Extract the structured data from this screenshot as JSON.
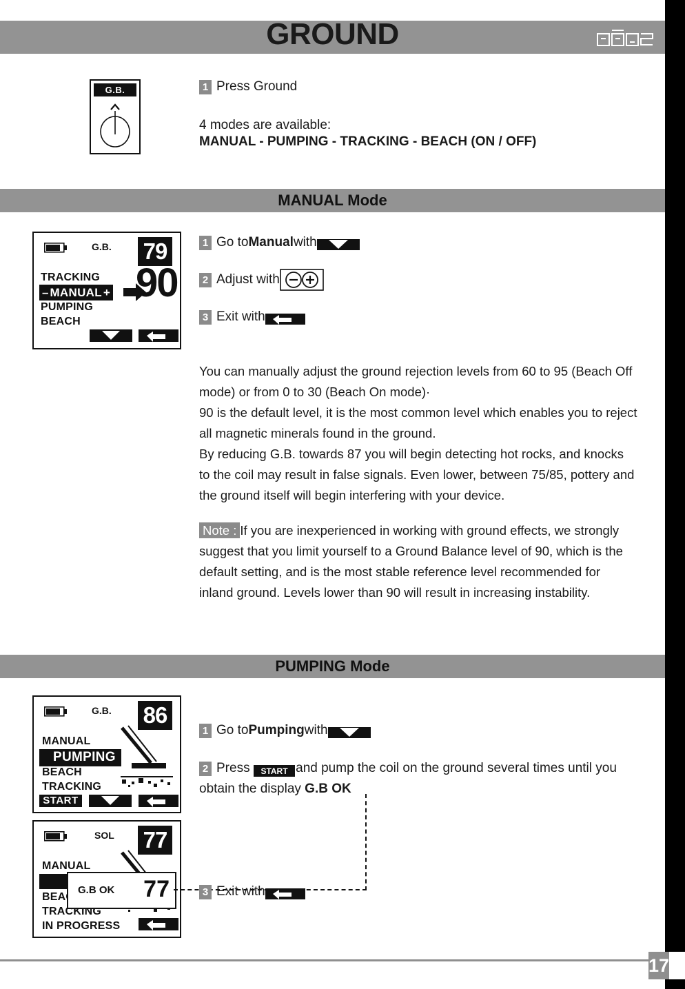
{
  "header": {
    "title": "GROUND",
    "logo_text": "DEUS"
  },
  "intro": {
    "knob_label": "G.B.",
    "step1_num": "1",
    "step1_text": "Press Ground",
    "modes_intro": "4 modes are available:",
    "modes_list": "MANUAL - PUMPING - TRACKING - BEACH (ON / OFF)"
  },
  "manual_section": {
    "heading": "MANUAL Mode",
    "lcd": {
      "gb_label": "G.B.",
      "small_value": "79",
      "big_value": "90",
      "menu": [
        "TRACKING",
        "MANUAL",
        "PUMPING",
        "BEACH"
      ],
      "selected": "MANUAL",
      "minus": "–",
      "plus": "+"
    },
    "steps": [
      {
        "num": "1",
        "pre": "Go to ",
        "bold": "Manual",
        "post": " with ",
        "icon": "down-arrow-button-icon"
      },
      {
        "num": "2",
        "pre": "Adjust with ",
        "bold": "",
        "post": "",
        "icon": "minus-plus-button-icon"
      },
      {
        "num": "3",
        "pre": "Exit with ",
        "bold": "",
        "post": "",
        "icon": "back-arrow-button-icon"
      }
    ],
    "paragraph1": "You can manually adjust the ground rejection levels from 60 to 95 (Beach Off mode) or from 0 to 30 (Beach On mode)·",
    "paragraph2": "90 is the default level, it is the most common level which enables you to reject all magnetic minerals found in the ground.",
    "paragraph3": "By reducing G.B. towards 87 you will begin detecting hot rocks, and knocks to the coil may result in false signals. Even lower, between 75/85, pottery and the ground itself will begin interfering with your device.",
    "note_badge": "Note :",
    "note_text": "If you are inexperienced in working with ground effects, we strongly suggest that you limit yourself to a Ground Balance level of 90, which is the default setting, and is the most stable reference level recommended for inland ground. Levels lower than 90 will result in increasing instability."
  },
  "pumping_section": {
    "heading": "PUMPING Mode",
    "lcd_top": {
      "gb_label": "G.B.",
      "small_value": "86",
      "menu": [
        "MANUAL",
        "PUMPING",
        "BEACH",
        "TRACKING"
      ],
      "selected": "PUMPING",
      "start_button": "START"
    },
    "lcd_bottom": {
      "gb_label": "SOL",
      "small_value": "77",
      "menu": [
        "MANUAL",
        "BEACH",
        "TRACKING"
      ],
      "status": "IN PROGRESS",
      "callout_text": "G.B OK",
      "callout_value": "77"
    },
    "steps": [
      {
        "num": "1",
        "pre": "Go to ",
        "bold": "Pumping",
        "post": " with ",
        "icon": "down-arrow-button-icon"
      },
      {
        "num": "2",
        "pre": "Press ",
        "bold": "",
        "post": "",
        "icon": "start-button-icon"
      },
      {
        "num": "3",
        "pre": "Exit with ",
        "bold": "",
        "post": "",
        "icon": "back-arrow-button-icon"
      }
    ],
    "step2_tail": " and pump the coil on the ground several times until you obtain the display ",
    "step2_bold_tail": "G.B OK",
    "start_label": "START"
  },
  "footer": {
    "page_number": "17"
  },
  "colors": {
    "gray_bar": "#939393",
    "badge_gray": "#8b8b8b",
    "black": "#111111"
  }
}
